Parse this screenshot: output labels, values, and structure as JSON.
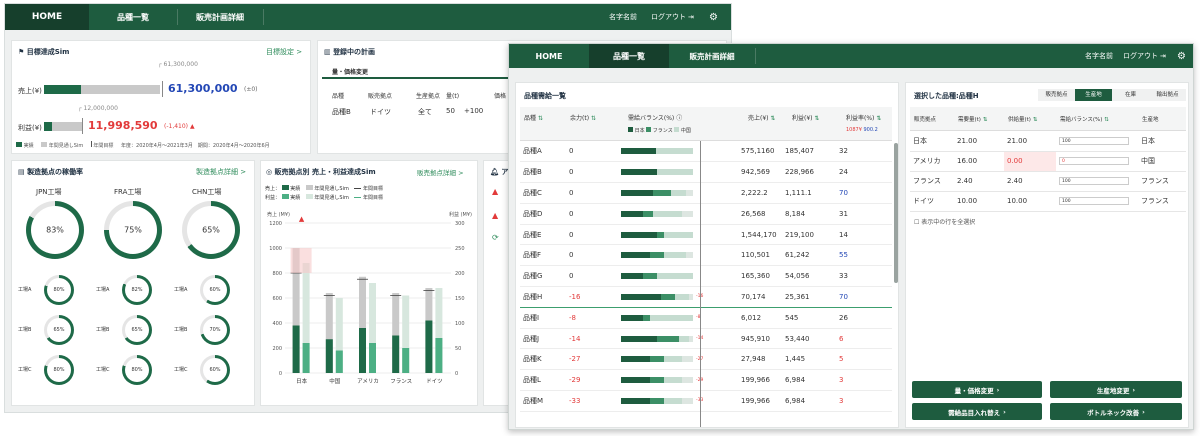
{
  "back": {
    "nav": {
      "home": "HOME",
      "tab1": "品種一覧",
      "tab2": "販売計画詳細",
      "user": "名字名前",
      "logout": "ログアウト"
    },
    "target": {
      "title": "目標達成Sim",
      "link": "目標設定 >",
      "sales_label": "売上(¥)",
      "profit_label": "利益(¥)",
      "sales_target": "61,300,000",
      "sales_value": "61,300,000",
      "sales_diff": "(±0)",
      "profit_target": "12,000,000",
      "profit_value": "11,998,590",
      "profit_diff": "(-1,410)",
      "legend_actual": "実績",
      "legend_sim": "年間見通しSim",
      "legend_target": "年間目標",
      "period": "年度：2020年4月～2021年3月　期間：2020年4月～2020年6月",
      "sales_actual_ratio": 0.32,
      "profit_actual_ratio": 0.22
    },
    "plan": {
      "title": "登録中の計画",
      "tab": "量・価格変更",
      "col1": "品種",
      "col2": "販売拠点",
      "col3": "生産拠点",
      "col4": "量(t)",
      "col5": "価格",
      "row_item": "品種B",
      "row_base": "ドイツ",
      "row_prod": "全て",
      "row_q1": "50",
      "row_q2": "+100"
    },
    "factory": {
      "title": "製造拠点の稼働率",
      "link": "製造拠点詳細 >",
      "plants": [
        {
          "name": "JPN工場",
          "pct": "83%",
          "ratio": 0.83,
          "lines": [
            {
              "name": "工場A",
              "pct": "80%",
              "ratio": 0.8
            },
            {
              "name": "工場B",
              "pct": "65%",
              "ratio": 0.65
            },
            {
              "name": "工場C",
              "pct": "80%",
              "ratio": 0.8
            }
          ]
        },
        {
          "name": "FRA工場",
          "pct": "75%",
          "ratio": 0.75,
          "lines": [
            {
              "name": "工場A",
              "pct": "82%",
              "ratio": 0.82
            },
            {
              "name": "工場B",
              "pct": "65%",
              "ratio": 0.65
            },
            {
              "name": "工場C",
              "pct": "80%",
              "ratio": 0.8
            }
          ]
        },
        {
          "name": "CHN工場",
          "pct": "65%",
          "ratio": 0.65,
          "lines": [
            {
              "name": "工場A",
              "pct": "60%",
              "ratio": 0.6
            },
            {
              "name": "工場B",
              "pct": "70%",
              "ratio": 0.7
            },
            {
              "name": "工場C",
              "pct": "60%",
              "ratio": 0.6
            }
          ]
        }
      ]
    },
    "sales": {
      "title": "販売拠点別 売上・利益達成Sim",
      "link": "販売拠点詳細 >",
      "sales_label": "売上：",
      "profit_label": "利益：",
      "legend_actual": "実績",
      "legend_sim": "年間見通しSim",
      "legend_target": "年間目標",
      "yl_unit": "売上\n(M¥)",
      "yr_unit": "利益\n(M¥)"
    },
    "alerts": {
      "title": "アラート"
    }
  },
  "chart_data": {
    "type": "bar",
    "categories": [
      "日本",
      "中国",
      "アメリカ",
      "フランス",
      "ドイツ"
    ],
    "ylim": [
      0,
      1200
    ],
    "y2lim": [
      0,
      300
    ],
    "yticks": [
      "1200",
      "1000",
      "800",
      "600",
      "400",
      "200",
      "0"
    ],
    "y2ticks": [
      "300",
      "250",
      "200",
      "150",
      "100",
      "50",
      "0"
    ],
    "series": [
      {
        "name": "実績",
        "values": [
          380,
          270,
          360,
          300,
          420
        ]
      },
      {
        "name": "年間見通しSim",
        "values": [
          1000,
          640,
          770,
          640,
          680
        ]
      },
      {
        "name": "年間目標",
        "values": [
          800,
          620,
          750,
          620,
          660
        ]
      }
    ],
    "profit_series": [
      {
        "name": "実績",
        "values": [
          60,
          45,
          60,
          50,
          70
        ]
      },
      {
        "name": "年間見通しSim",
        "values": [
          220,
          150,
          180,
          155,
          170
        ]
      }
    ]
  },
  "front": {
    "nav": {
      "home": "HOME",
      "tab1": "品種一覧",
      "tab2": "販売計画詳細",
      "user": "名字名前",
      "logout": "ログアウト"
    },
    "list": {
      "title": "品種需給一覧",
      "headers": [
        "品種",
        "余力(t)",
        "需給バランス(%)",
        "売上(¥)",
        "利益(¥)",
        "利益率(%)"
      ],
      "sub_legend_jp": "日本",
      "sub_legend_fr": "フランス",
      "sub_legend_cn": "中国",
      "rate_low": "1087¥",
      "rate_high": "900.2",
      "rows": [
        {
          "name": "品種A",
          "rest": "0",
          "sales": "575,1160",
          "profit": "185,407",
          "rate": "32",
          "b1": 0.48,
          "b2": 0.0,
          "b3": 1.0,
          "neg": false
        },
        {
          "name": "品種B",
          "rest": "0",
          "sales": "942,569",
          "profit": "228,966",
          "rate": "24",
          "b1": 0.5,
          "b2": 0.0,
          "b3": 1.0,
          "neg": false
        },
        {
          "name": "品種C",
          "rest": "0",
          "sales": "2,222.2",
          "profit": "1,111.1",
          "rate": "70",
          "b1": 0.45,
          "b2": 0.25,
          "b3": 0.9,
          "neg": false
        },
        {
          "name": "品種D",
          "rest": "0",
          "sales": "26,568",
          "profit": "8,184",
          "rate": "31",
          "b1": 0.3,
          "b2": 0.15,
          "b3": 0.85,
          "neg": false
        },
        {
          "name": "品種E",
          "rest": "0",
          "sales": "1,544,170",
          "profit": "219,100",
          "rate": "14",
          "b1": 0.5,
          "b2": 0.1,
          "b3": 1.0,
          "neg": false
        },
        {
          "name": "品種F",
          "rest": "0",
          "sales": "110,501",
          "profit": "61,242",
          "rate": "55",
          "b1": 0.4,
          "b2": 0.2,
          "b3": 0.9,
          "neg": false
        },
        {
          "name": "品種G",
          "rest": "0",
          "sales": "165,360",
          "profit": "54,056",
          "rate": "33",
          "b1": 0.3,
          "b2": 0.2,
          "b3": 1.0,
          "neg": false
        },
        {
          "name": "品種H",
          "rest": "-16",
          "sales": "70,174",
          "profit": "25,361",
          "rate": "70",
          "b1": 0.55,
          "b2": 0.2,
          "b3": 0.95,
          "neg": true,
          "pct": "-16",
          "sel": true
        },
        {
          "name": "品種I",
          "rest": "-8",
          "sales": "6,012",
          "profit": "545",
          "rate": "26",
          "b1": 0.3,
          "b2": 0.1,
          "b3": 1.0,
          "neg": true,
          "pct": "-8"
        },
        {
          "name": "品種J",
          "rest": "-14",
          "sales": "945,910",
          "profit": "53,440",
          "rate": "6",
          "b1": 0.5,
          "b2": 0.3,
          "b3": 0.95,
          "neg": true,
          "pct": "-14"
        },
        {
          "name": "品種K",
          "rest": "-27",
          "sales": "27,948",
          "profit": "1,445",
          "rate": "5",
          "b1": 0.4,
          "b2": 0.2,
          "b3": 0.85,
          "neg": true,
          "pct": "-27"
        },
        {
          "name": "品種L",
          "rest": "-29",
          "sales": "199,966",
          "profit": "6,984",
          "rate": "3",
          "b1": 0.4,
          "b2": 0.2,
          "b3": 0.85,
          "neg": true,
          "pct": "-29"
        },
        {
          "name": "品種M",
          "rest": "-33",
          "sales": "199,966",
          "profit": "6,984",
          "rate": "3",
          "b1": 0.4,
          "b2": 0.2,
          "b3": 0.85,
          "neg": true,
          "pct": "-33"
        }
      ]
    },
    "detail": {
      "title": "選択した品種:品種H",
      "tabs": [
        "販売拠点",
        "生産地",
        "在庫",
        "輸出拠点"
      ],
      "headers": [
        "販売拠点",
        "需要量(t)",
        "供給量(t)",
        "需給バランス(%)",
        "生産地"
      ],
      "rows": [
        {
          "base": "日本",
          "demand": "21.00",
          "supply": "21.00",
          "pct": "100",
          "prod": "日本",
          "neg": false
        },
        {
          "base": "アメリカ",
          "demand": "16.00",
          "supply": "0.00",
          "pct": "0",
          "prod": "中国",
          "neg": true
        },
        {
          "base": "フランス",
          "demand": "2.40",
          "supply": "2.40",
          "pct": "100",
          "prod": "フランス",
          "neg": false
        },
        {
          "base": "ドイツ",
          "demand": "10.00",
          "supply": "10.00",
          "pct": "100",
          "prod": "フランス",
          "neg": false
        }
      ],
      "select_all": "表示中の行を全選択",
      "btn1": "量・価格変更",
      "btn2": "生産地変更",
      "btn3": "需給品目入れ替え",
      "btn4": "ボトルネック改善"
    }
  }
}
